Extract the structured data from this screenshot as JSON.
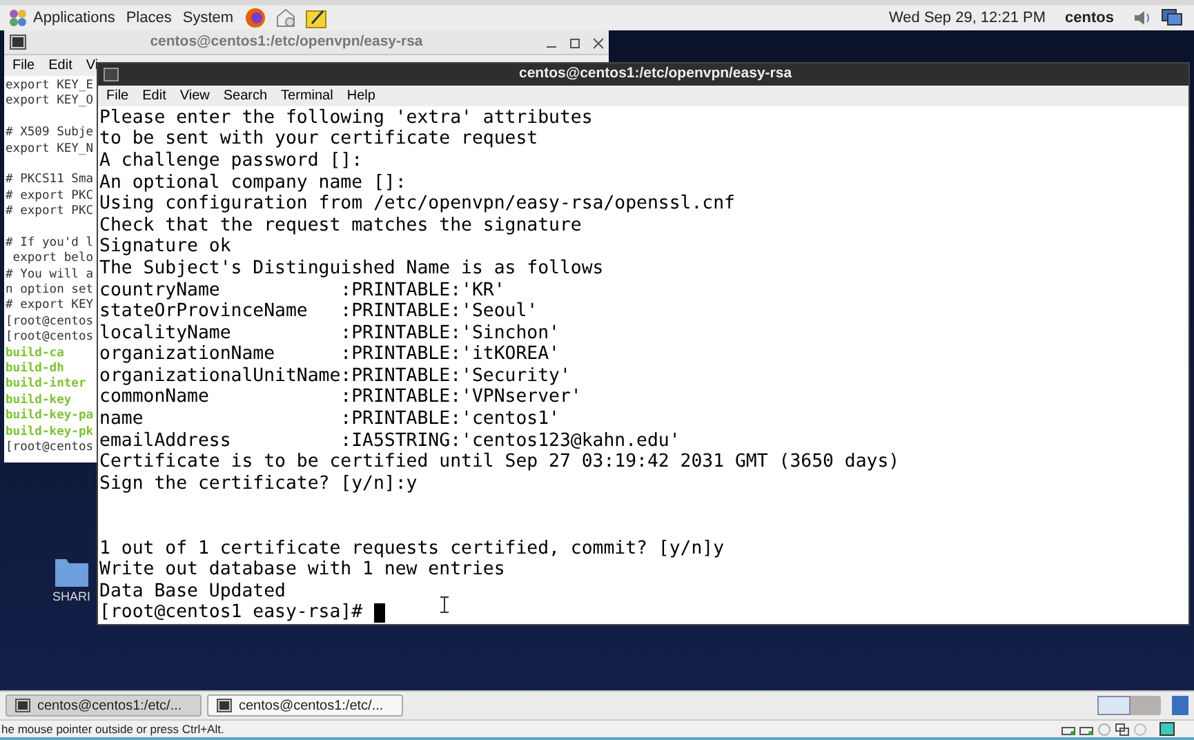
{
  "top_panel": {
    "menus": [
      "Applications",
      "Places",
      "System"
    ],
    "clock": "Wed Sep 29, 12:21 PM",
    "user": "centos"
  },
  "back_window": {
    "title": "centos@centos1:/etc/openvpn/easy-rsa",
    "menu": [
      "File",
      "Edit",
      "Vi"
    ],
    "lines": [
      {
        "text": "export KEY_E",
        "kind": "plain"
      },
      {
        "text": "export KEY_O",
        "kind": "plain"
      },
      {
        "kind": "blank"
      },
      {
        "text": "# X509 Subje",
        "kind": "plain"
      },
      {
        "text": "export KEY_N",
        "kind": "plain"
      },
      {
        "kind": "blank"
      },
      {
        "text": "# PKCS11 Sma",
        "kind": "plain"
      },
      {
        "text": "# export PKC",
        "kind": "plain"
      },
      {
        "text": "# export PKC",
        "kind": "plain"
      },
      {
        "kind": "blank"
      },
      {
        "text": "# If you'd l",
        "kind": "plain"
      },
      {
        "text": " export belo",
        "kind": "plain"
      },
      {
        "text": "# You will a",
        "kind": "plain"
      },
      {
        "text": "n option set",
        "kind": "plain"
      },
      {
        "text": "# export KEY",
        "kind": "plain"
      },
      {
        "text": "[root@centos",
        "kind": "plain"
      },
      {
        "text": "[root@centos",
        "kind": "plain"
      },
      {
        "text": "build-ca",
        "kind": "executable"
      },
      {
        "text": "build-dh",
        "kind": "executable"
      },
      {
        "text": "build-inter",
        "kind": "executable"
      },
      {
        "text": "build-key",
        "kind": "executable"
      },
      {
        "text": "build-key-pa",
        "kind": "executable"
      },
      {
        "text": "build-key-pk",
        "kind": "executable"
      },
      {
        "text": "[root@centos",
        "kind": "plain"
      }
    ]
  },
  "front_window": {
    "title": "centos@centos1:/etc/openvpn/easy-rsa",
    "menu": [
      "File",
      "Edit",
      "View",
      "Search",
      "Terminal",
      "Help"
    ],
    "lines": [
      "Please enter the following 'extra' attributes",
      "to be sent with your certificate request",
      "A challenge password []:",
      "An optional company name []:",
      "Using configuration from /etc/openvpn/easy-rsa/openssl.cnf",
      "Check that the request matches the signature",
      "Signature ok",
      "The Subject's Distinguished Name is as follows",
      "countryName           :PRINTABLE:'KR'",
      "stateOrProvinceName   :PRINTABLE:'Seoul'",
      "localityName          :PRINTABLE:'Sinchon'",
      "organizationName      :PRINTABLE:'itKOREA'",
      "organizationalUnitName:PRINTABLE:'Security'",
      "commonName            :PRINTABLE:'VPNserver'",
      "name                  :PRINTABLE:'centos1'",
      "emailAddress          :IA5STRING:'centos123@kahn.edu'",
      "Certificate is to be certified until Sep 27 03:19:42 2031 GMT (3650 days)",
      "Sign the certificate? [y/n]:y",
      {
        "kind": "blank"
      },
      {
        "kind": "blank"
      },
      "1 out of 1 certificate requests certified, commit? [y/n]y",
      "Write out database with 1 new entries",
      "Data Base Updated",
      "[root@centos1 easy-rsa]# "
    ],
    "cursor_visible": true
  },
  "desktop_icons": [
    {
      "label": "SHARI"
    }
  ],
  "taskbar": [
    {
      "label": "centos@centos1:/etc/...",
      "selected": true
    },
    {
      "label": "centos@centos1:/etc/...",
      "selected": false
    }
  ],
  "status_bar": {
    "message": "he mouse pointer outside or press Ctrl+Alt."
  }
}
